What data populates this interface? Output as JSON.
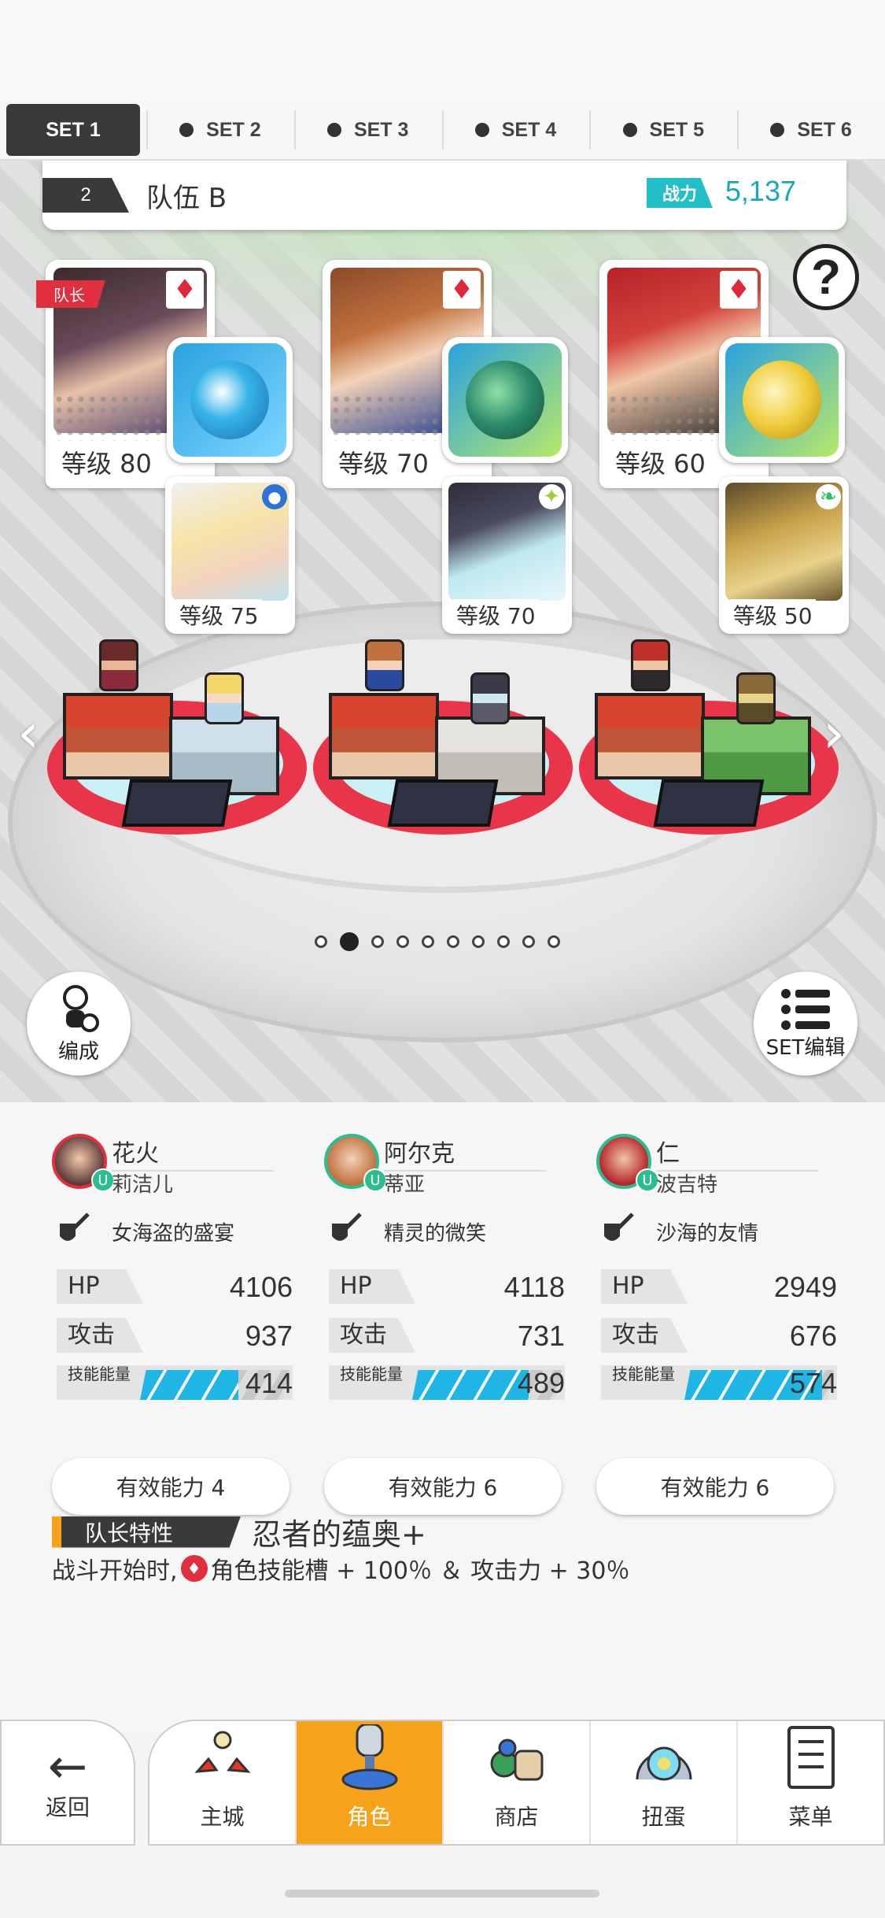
{
  "tabs": [
    {
      "label": "SET 1",
      "active": true
    },
    {
      "label": "SET 2",
      "active": false
    },
    {
      "label": "SET 3",
      "active": false
    },
    {
      "label": "SET 4",
      "active": false
    },
    {
      "label": "SET 5",
      "active": false
    },
    {
      "label": "SET 6",
      "active": false
    }
  ],
  "team": {
    "number": "2",
    "name": "队伍 B",
    "power_label": "战力",
    "power_value": "5,137"
  },
  "cards": [
    {
      "leader_tag": "队长",
      "level": "等级 80",
      "sub_level": "等级 75"
    },
    {
      "level": "等级 70",
      "sub_level": "等级 70"
    },
    {
      "level": "等级 60",
      "sub_level": "等级 50"
    }
  ],
  "buttons": {
    "formation": "编成",
    "set_edit": "SET编辑",
    "help": "?"
  },
  "pager": {
    "pages": 10,
    "current": 2
  },
  "members": [
    {
      "name": "花火",
      "sub": "莉洁儿",
      "weapon": "女海盗的盛宴",
      "hp_label": "HP",
      "hp": "4106",
      "atk_label": "攻击",
      "atk": "937",
      "energy_label": "技能能量",
      "energy": "414",
      "energy_fill": 0.66,
      "ability": "有效能力 4"
    },
    {
      "name": "阿尔克",
      "sub": "蒂亚",
      "weapon": "精灵的微笑",
      "hp_label": "HP",
      "hp": "4118",
      "atk_label": "攻击",
      "atk": "731",
      "energy_label": "技能能量",
      "energy": "489",
      "energy_fill": 0.78,
      "ability": "有效能力 6"
    },
    {
      "name": "仁",
      "sub": "波吉特",
      "weapon": "沙海的友情",
      "hp_label": "HP",
      "hp": "2949",
      "atk_label": "攻击",
      "atk": "676",
      "energy_label": "技能能量",
      "energy": "574",
      "energy_fill": 0.92,
      "ability": "有效能力 6"
    }
  ],
  "leader_trait": {
    "tag": "队长特性",
    "name": "忍者的蕴奥+",
    "desc_before": "战斗开始时,",
    "desc_after": "角色技能槽 + 100％ ＆ 攻击力 + 30％"
  },
  "nav": {
    "back": "返回",
    "items": [
      {
        "label": "主城",
        "icon": "castle-icon"
      },
      {
        "label": "角色",
        "icon": "character-icon",
        "active": true
      },
      {
        "label": "商店",
        "icon": "shop-icon"
      },
      {
        "label": "扭蛋",
        "icon": "gacha-icon"
      },
      {
        "label": "菜单",
        "icon": "menu-icon"
      }
    ]
  },
  "colors": {
    "accent_orange": "#f7a21b",
    "power_teal": "#16aab8",
    "leader_red": "#e03040",
    "energy_blue": "#1fb6e6"
  }
}
